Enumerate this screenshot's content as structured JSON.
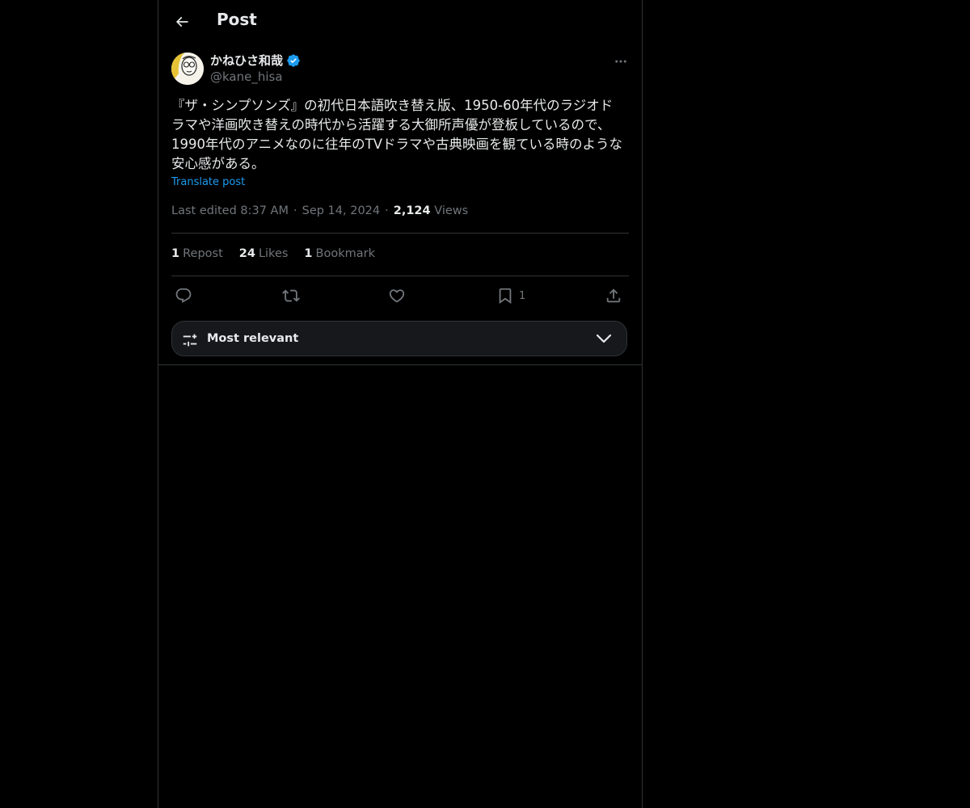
{
  "header": {
    "title": "Post",
    "back_icon": "arrow-left-icon"
  },
  "author": {
    "display_name": "かねひさ和哉",
    "handle": "@kane_hisa",
    "verified": true,
    "verified_color": "#1d9bf0"
  },
  "post": {
    "text": "『ザ・シンプソンズ』の初代日本語吹き替え版、1950-60年代のラジオドラマや洋画吹き替えの時代から活躍する大御所声優が登板しているので、1990年代のアニメなのに往年のTVドラマや古典映画を観ている時のような安心感がある。",
    "translate_label": "Translate post",
    "meta": {
      "edited_label": "Last edited 8:37 AM",
      "date": "Sep 14, 2024",
      "views_count": "2,124",
      "views_label": "Views",
      "separator": "·"
    }
  },
  "stats": {
    "reposts_count": "1",
    "reposts_label": "Repost",
    "likes_count": "24",
    "likes_label": "Likes",
    "bookmarks_count": "1",
    "bookmarks_label": "Bookmark"
  },
  "actions": {
    "reply_icon": "reply-icon",
    "repost_icon": "repost-icon",
    "like_icon": "heart-icon",
    "bookmark_icon": "bookmark-icon",
    "bookmark_count": "1",
    "share_icon": "share-icon"
  },
  "sort": {
    "label": "Most relevant",
    "icon": "sliders-icon",
    "chevron": "chevron-down-icon"
  },
  "colors": {
    "background": "#000000",
    "text_primary": "#e7e9ea",
    "text_secondary": "#71767b",
    "link": "#1d9bf0",
    "border": "#2f3336"
  }
}
